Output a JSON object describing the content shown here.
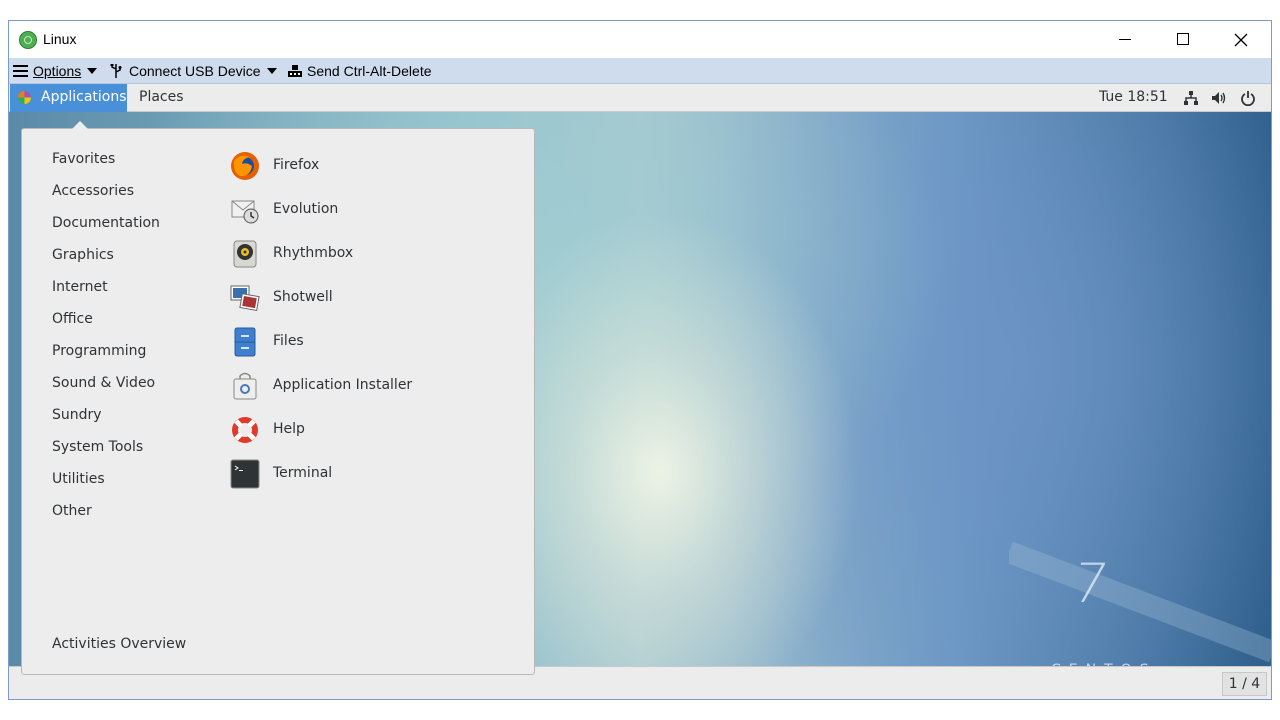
{
  "window": {
    "title": "Linux"
  },
  "toolbar": {
    "options_label": "Options",
    "usb_label": "Connect USB Device",
    "cad_label": "Send Ctrl-Alt-Delete"
  },
  "topbar": {
    "applications_label": "Applications",
    "places_label": "Places",
    "clock": "Tue 18:51"
  },
  "menu": {
    "categories": [
      "Favorites",
      "Accessories",
      "Documentation",
      "Graphics",
      "Internet",
      "Office",
      "Programming",
      "Sound & Video",
      "Sundry",
      "System Tools",
      "Utilities",
      "Other"
    ],
    "apps": [
      {
        "label": "Firefox",
        "icon": "firefox-icon"
      },
      {
        "label": "Evolution",
        "icon": "evolution-icon"
      },
      {
        "label": "Rhythmbox",
        "icon": "rhythmbox-icon"
      },
      {
        "label": "Shotwell",
        "icon": "shotwell-icon"
      },
      {
        "label": "Files",
        "icon": "files-icon"
      },
      {
        "label": "Application Installer",
        "icon": "application-installer-icon"
      },
      {
        "label": "Help",
        "icon": "help-icon"
      },
      {
        "label": "Terminal",
        "icon": "terminal-icon"
      }
    ],
    "activities_label": "Activities Overview"
  },
  "desktop": {
    "version_number": "7",
    "brand": "CENTOS"
  },
  "statusbar": {
    "pager": "1 / 4"
  },
  "colors": {
    "accent": "#4a90d9",
    "toolbar": "#cfdcee"
  }
}
